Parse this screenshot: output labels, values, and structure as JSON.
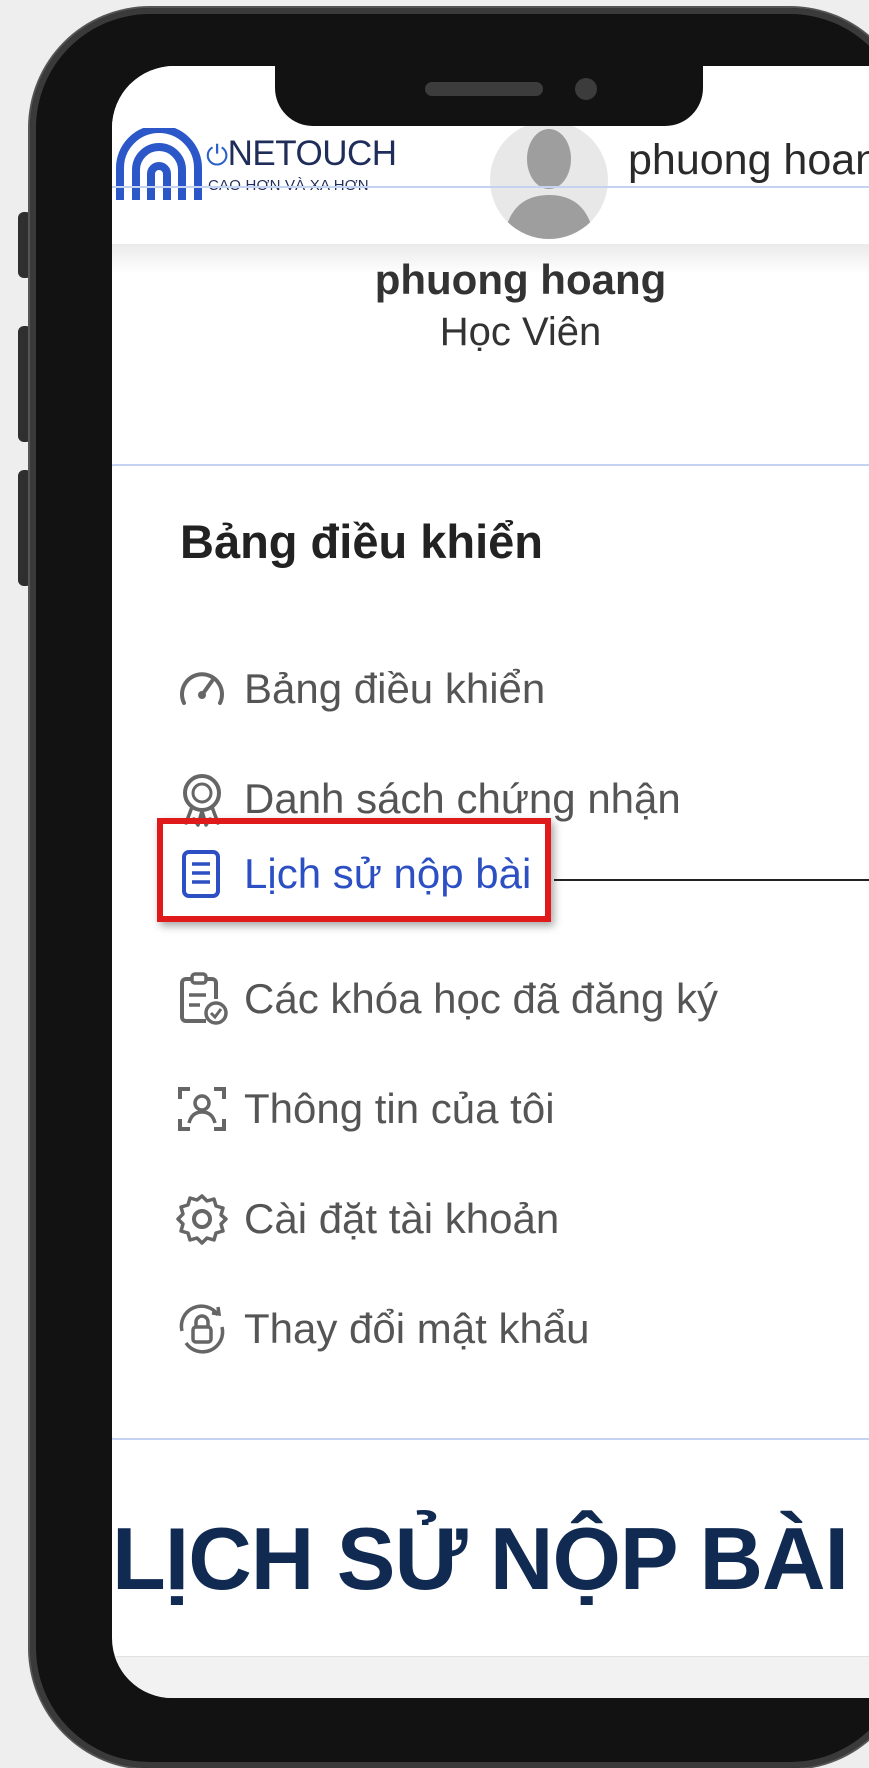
{
  "header": {
    "logo_brand": "NETOUCH",
    "logo_tagline": "CAO HƠN VÀ XA HƠN",
    "user_name": "phuong hoan"
  },
  "profile": {
    "name": "phuong hoang",
    "role": "Học Viên"
  },
  "menu": {
    "title": "Bảng điều khiển",
    "items": [
      {
        "label": "Bảng điều khiển",
        "icon": "speedometer-icon"
      },
      {
        "label": "Danh sách chứng nhận",
        "icon": "award-icon"
      },
      {
        "label": "Lịch sử nộp bài",
        "icon": "document-list-icon",
        "active": true
      },
      {
        "label": "Các khóa học đã đăng ký",
        "icon": "clipboard-check-icon"
      },
      {
        "label": "Thông tin của tôi",
        "icon": "user-scan-icon"
      },
      {
        "label": "Cài đặt tài khoản",
        "icon": "gear-icon"
      },
      {
        "label": "Thay đổi mật khẩu",
        "icon": "lock-refresh-icon"
      }
    ]
  },
  "page": {
    "heading": "LỊCH SỬ NỘP BÀI"
  },
  "colors": {
    "active": "#2c4fc4",
    "highlight": "#e01a1a",
    "heading": "#102a52",
    "brand": "#1f2d5a"
  }
}
